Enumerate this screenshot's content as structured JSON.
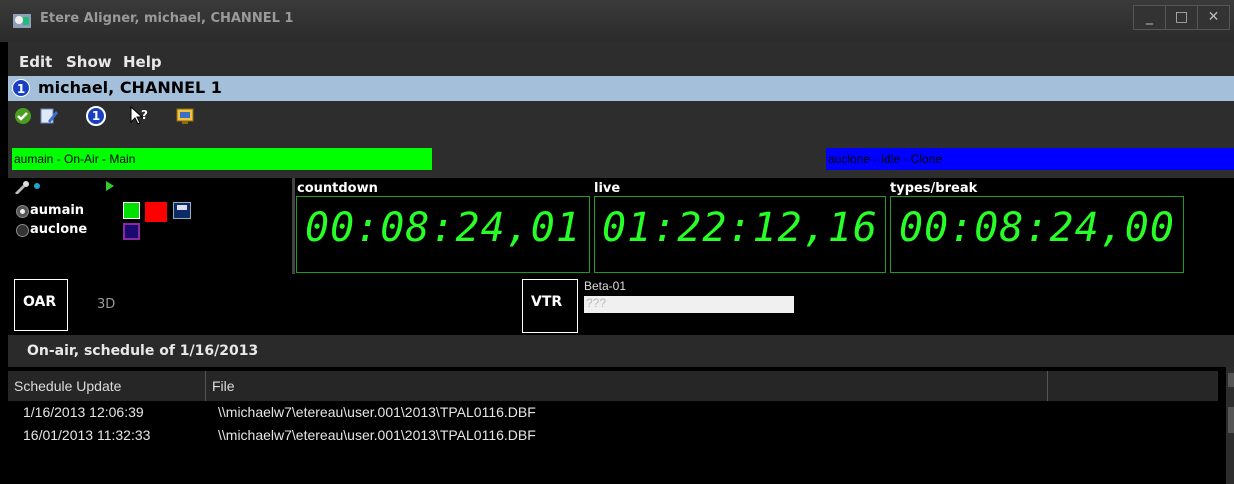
{
  "window": {
    "title": "Etere Aligner, michael, CHANNEL 1",
    "controls": [
      "_",
      "□",
      "✕"
    ]
  },
  "menu": {
    "items": [
      "Edit",
      "Show",
      "Help"
    ]
  },
  "channel": {
    "badge": "1",
    "title": "michael, CHANNEL 1"
  },
  "toolbar": {
    "buttons": [
      "confirm-icon",
      "edit-icon",
      "channel-1-icon",
      "help-pointer-icon",
      "monitor-icon"
    ],
    "badge": "1",
    "help_glyph": "?"
  },
  "status": {
    "main": {
      "text": "aumain - On-Air - Main",
      "color": "#00ff00"
    },
    "clone": {
      "text": "auclone - Idle - Clone",
      "color": "#0000ff"
    }
  },
  "servers": {
    "items": [
      {
        "label": "aumain",
        "selected": true
      },
      {
        "label": "auclone",
        "selected": false
      }
    ]
  },
  "timers": {
    "countdown": {
      "label": "countdown",
      "value": "00:08:24,01"
    },
    "live": {
      "label": "live",
      "value": "01:22:12,16"
    },
    "types_break": {
      "label": "types/break",
      "value": "00:08:24,00"
    }
  },
  "devices": {
    "oar_label": "OAR",
    "mode_3d": "3D",
    "vtr_label": "VTR",
    "vtr_name": "Beta-01",
    "vtr_value": "???"
  },
  "schedule": {
    "title": "On-air, schedule of 1/16/2013",
    "columns": [
      "Schedule Update",
      "File"
    ],
    "rows": [
      {
        "update": "1/16/2013 12:06:39",
        "file": "\\\\michaelw7\\etereau\\user.001\\2013\\TPAL0116.DBF"
      },
      {
        "update": "16/01/2013 11:32:33",
        "file": "\\\\michaelw7\\etereau\\user.001\\2013\\TPAL0116.DBF"
      }
    ]
  }
}
